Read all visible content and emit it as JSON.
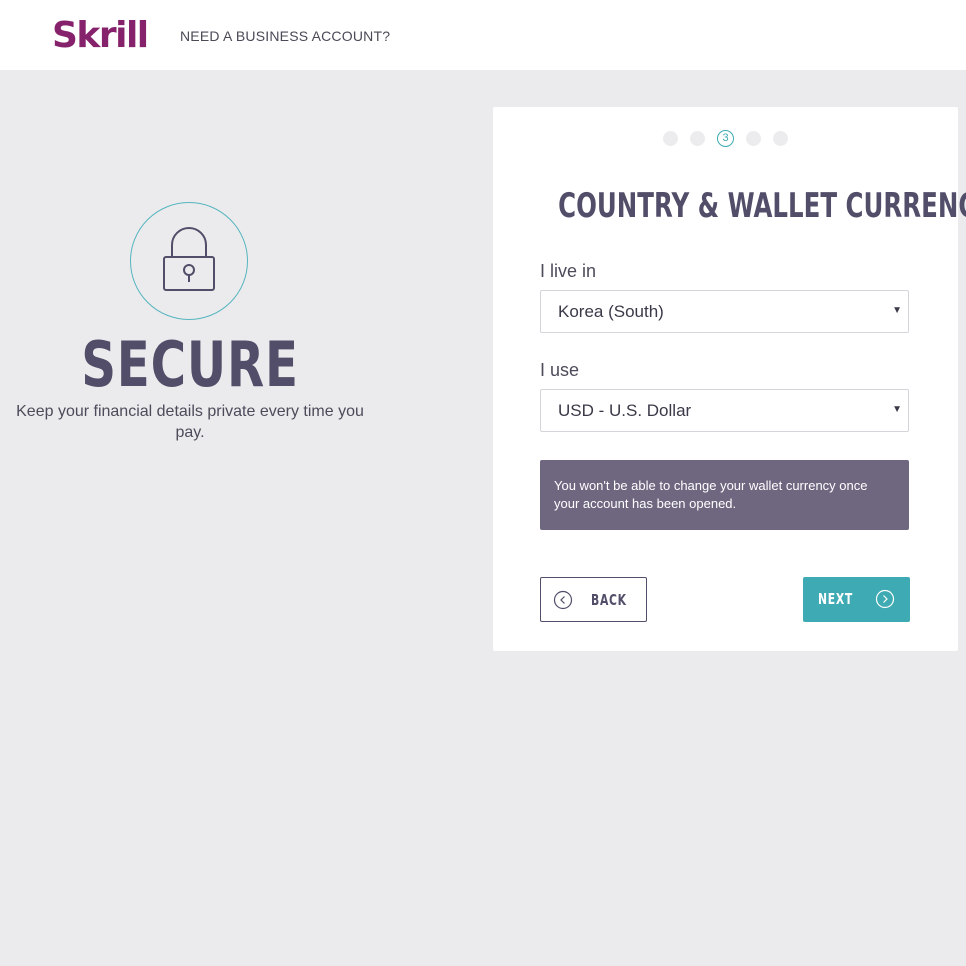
{
  "header": {
    "logo_text": "Skrill",
    "business_link": "NEED A BUSINESS ACCOUNT?"
  },
  "promo": {
    "title": "SECURE",
    "text": "Keep your financial details private every time you pay.",
    "icon": "padlock-icon"
  },
  "steps": {
    "total": 5,
    "current": 3,
    "current_label": "3"
  },
  "form": {
    "title": "COUNTRY & WALLET CURRENCY",
    "country_label": "I live in",
    "country_value": "Korea (South)",
    "currency_label": "I use",
    "currency_value": "USD - U.S. Dollar",
    "notice": "You won't be able to change your wallet currency once your account has been opened.",
    "back_label": "BACK",
    "next_label": "NEXT"
  },
  "colors": {
    "brand": "#86226b",
    "accent": "#3eaab4",
    "heading": "#524e69",
    "notice_bg": "#6f6680",
    "background": "#ebebed"
  }
}
